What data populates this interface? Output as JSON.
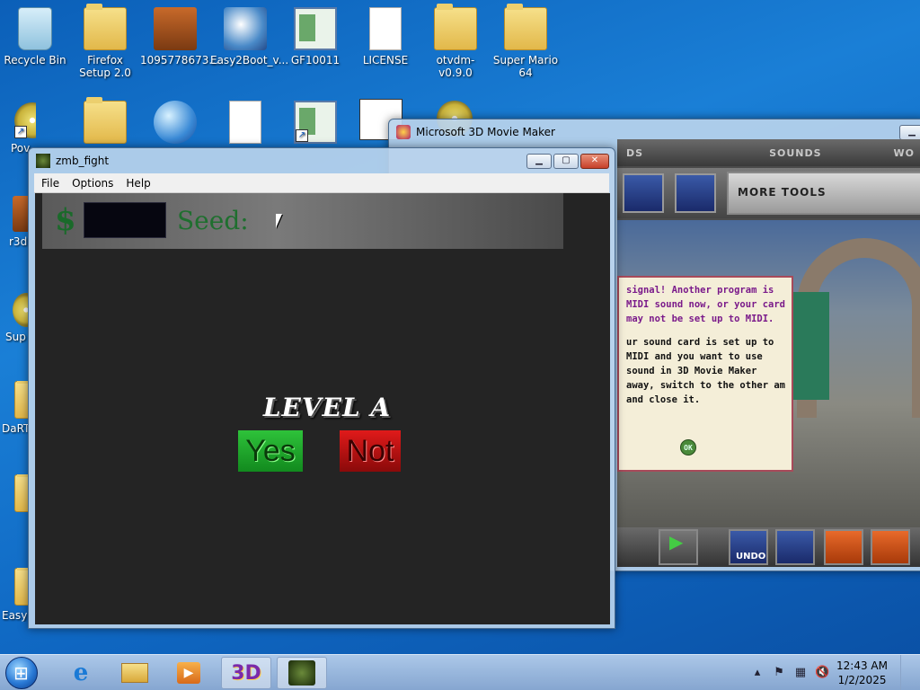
{
  "desktop": {
    "icons": [
      {
        "label": "Recycle Bin",
        "icon": "recycle-bin-icon"
      },
      {
        "label": "Firefox Setup 2.0",
        "icon": "folder-icon"
      },
      {
        "label": "1095778673...",
        "icon": "app-icon"
      },
      {
        "label": "Easy2Boot_v...",
        "icon": "setup-icon"
      },
      {
        "label": "GF10011",
        "icon": "window-file-icon"
      },
      {
        "label": "LICENSE",
        "icon": "document-icon"
      },
      {
        "label": "otvdm-v0.9.0",
        "icon": "zip-folder-icon"
      },
      {
        "label": "Super Mario 64",
        "icon": "zip-folder-icon"
      }
    ],
    "partial_labels": [
      "Pov",
      "r3d",
      "Sup",
      "DaRT",
      "Easy2"
    ]
  },
  "moviemaker_window": {
    "title": "Microsoft 3D Movie Maker",
    "tabs": [
      "DS",
      "SOUNDS",
      "WO"
    ],
    "more_tools_label": "MORE TOOLS",
    "dialog_para1": "signal! Another program is MIDI sound now, or your card may not be set up to MIDI.",
    "dialog_para2": "ur sound card is set up to MIDI and you want to use sound in 3D Movie Maker away, switch to the other am and close it.",
    "ok_label": "OK",
    "undo_label": "UNDO"
  },
  "zmb_window": {
    "title": "zmb_fight",
    "menu": [
      "File",
      "Options",
      "Help"
    ],
    "hud": {
      "currency_symbol": "$",
      "money_value": "",
      "seed_label": "Seed:",
      "seed_value": ""
    },
    "level_title": "LEVEL A",
    "yes_label": "Yes",
    "not_label": "Not"
  },
  "taskbar": {
    "time": "12:43 AM",
    "date": "1/2/2025"
  },
  "colors": {
    "yes_green": "#1fa82c",
    "not_red": "#c01010",
    "hud_green": "#1f6f2f"
  }
}
